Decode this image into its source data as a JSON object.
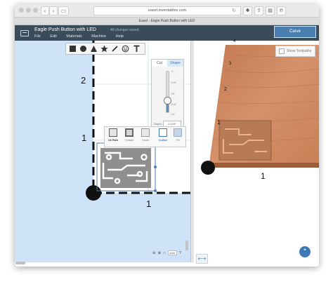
{
  "browser": {
    "url": "easel.inventables.com",
    "tab_title": "Easel - Eagle Push Button with LED"
  },
  "app": {
    "doc_title": "Eagle Push Button with LED",
    "save_status": "All changes saved",
    "menu": [
      "File",
      "Edit",
      "Materials",
      "Machine",
      "Help"
    ],
    "carve_label": "Carve"
  },
  "canvas": {
    "axis_labels": {
      "y_2": "2",
      "y_1": "1",
      "x_1": "1"
    },
    "zoom_unit": "inch"
  },
  "shape_tools": [
    "square-tool",
    "circle-tool",
    "triangle-tool",
    "star-tool",
    "pen-tool",
    "smiley-tool",
    "text-tool"
  ],
  "cut_panel": {
    "tabs": [
      "Cut",
      "Shape"
    ],
    "active_tab": "Cut",
    "depth_scale": [
      "0\"",
      "1/16\"",
      "1/8\"",
      "3/16\"",
      "1/4\""
    ],
    "depth_label": "Depth:",
    "depth_value": "0.125\""
  },
  "path_options": [
    "On Path",
    "Outside",
    "Inside",
    "Outline",
    "Fill"
  ],
  "preview": {
    "show_toolpaths_label": "Show Toolpaths",
    "axis_labels": [
      "4",
      "3",
      "2",
      "1",
      "1"
    ]
  },
  "colors": {
    "header": "#3a4c5a",
    "canvas": "#cfe3f8",
    "accent": "#4b7fb0",
    "wood": "#c9825a"
  }
}
